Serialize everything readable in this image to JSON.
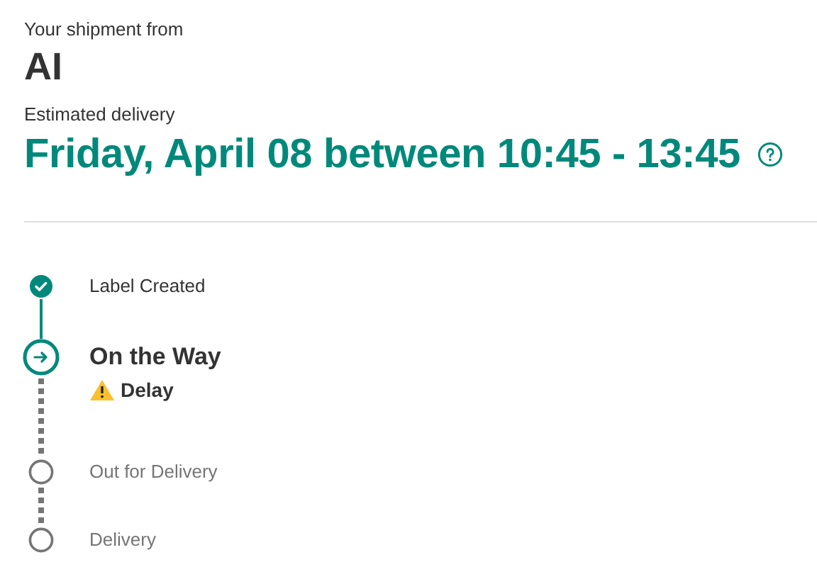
{
  "header": {
    "caption": "Your shipment from",
    "sender": "AI",
    "delivery_caption": "Estimated delivery",
    "delivery_window": "Friday, April 08 between 10:45 - 13:45"
  },
  "steps": [
    {
      "label": "Label Created",
      "kind": "done"
    },
    {
      "label": "On the Way",
      "kind": "current",
      "alert": "Delay"
    },
    {
      "label": "Out for Delivery",
      "kind": "pending"
    },
    {
      "label": "Delivery",
      "kind": "pending"
    }
  ]
}
